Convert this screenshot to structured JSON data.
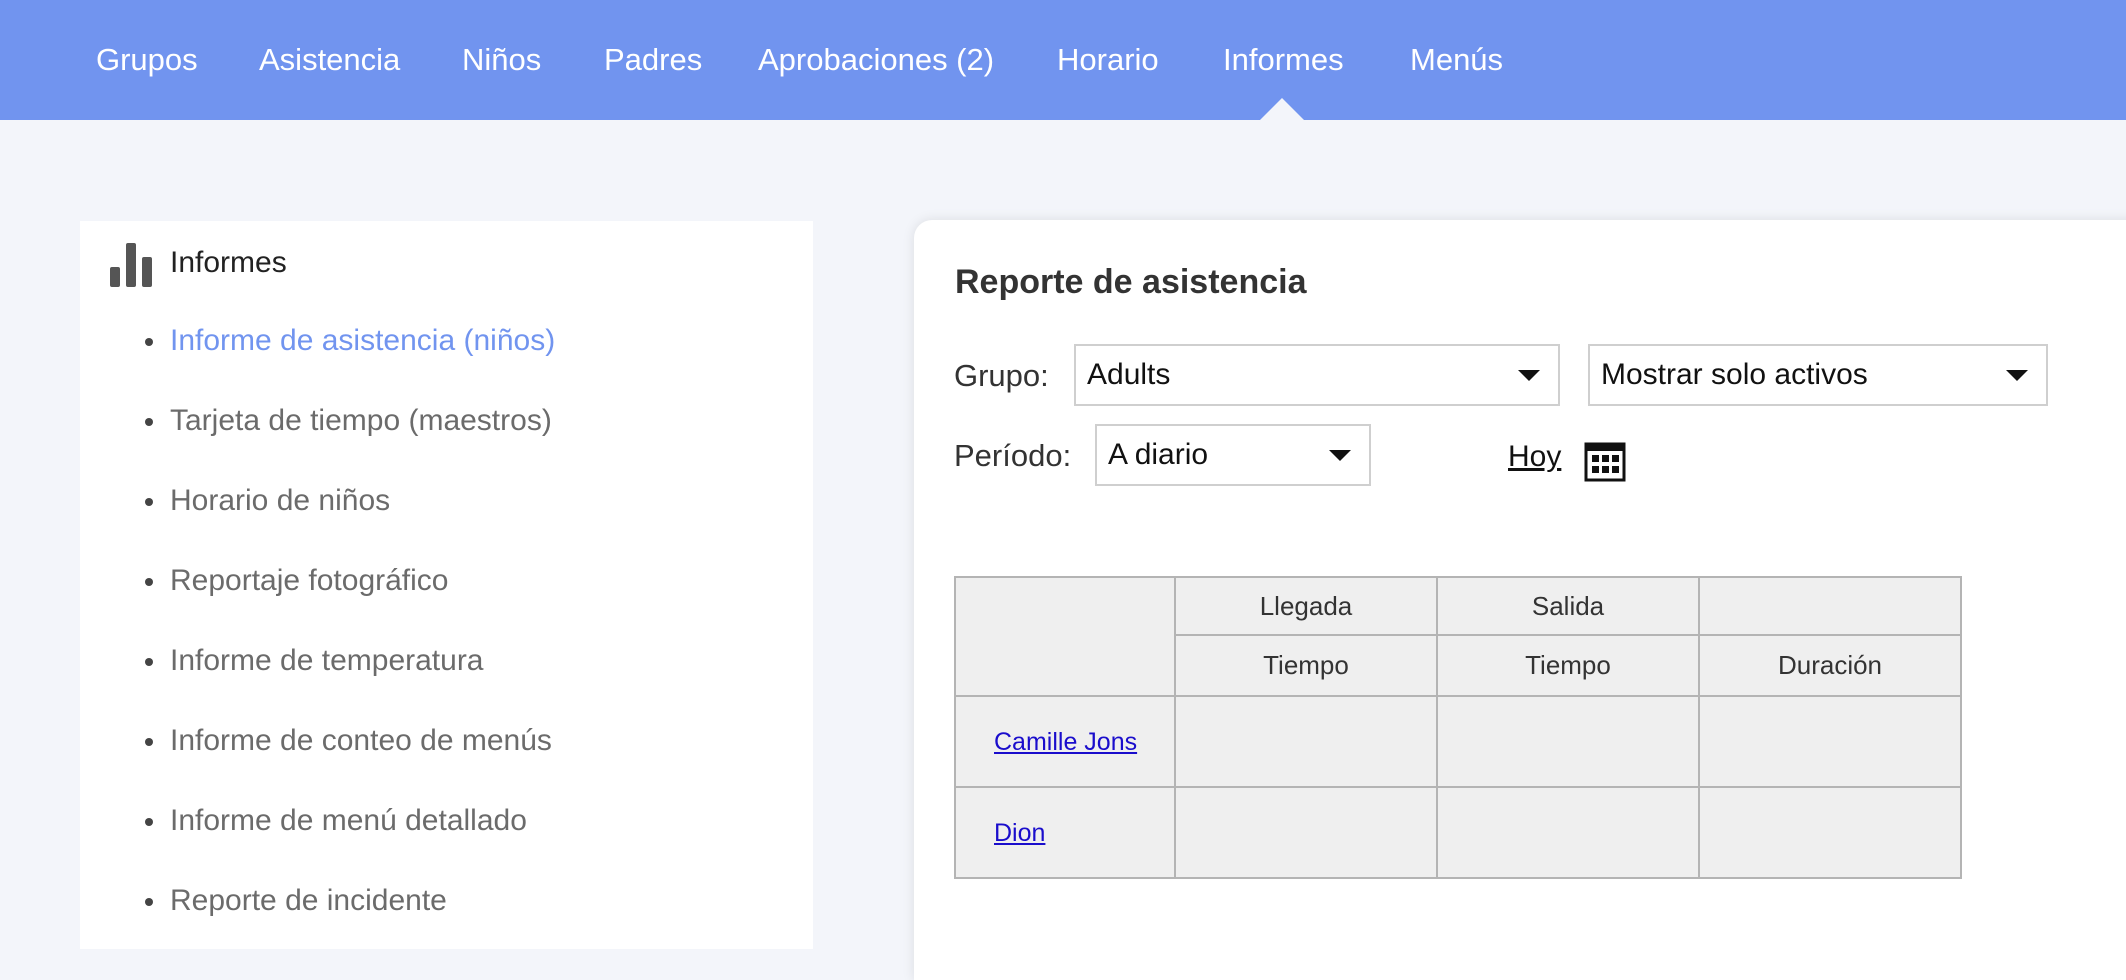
{
  "nav": {
    "items": [
      {
        "label": "Grupos"
      },
      {
        "label": "Asistencia"
      },
      {
        "label": "Niños"
      },
      {
        "label": "Padres"
      },
      {
        "label": "Aprobaciones (2)"
      },
      {
        "label": "Horario"
      },
      {
        "label": "Informes",
        "active": true
      },
      {
        "label": "Menús"
      }
    ]
  },
  "sidebar": {
    "title": "Informes",
    "title_icon": "bar-chart-icon",
    "items": [
      {
        "label": "Informe de asistencia (niños)",
        "active": true
      },
      {
        "label": "Tarjeta de tiempo (maestros)"
      },
      {
        "label": "Horario de niños"
      },
      {
        "label": "Reportaje fotográfico"
      },
      {
        "label": "Informe de temperatura"
      },
      {
        "label": "Informe de conteo de menús"
      },
      {
        "label": "Informe de menú detallado"
      },
      {
        "label": "Reporte de incidente"
      }
    ]
  },
  "report": {
    "title": "Reporte de asistencia",
    "group_label": "Grupo:",
    "group_value": "Adults",
    "filter_value": "Mostrar solo activos",
    "period_label": "Período:",
    "period_value": "A diario",
    "today_link": "Hoy",
    "calendar_icon": "calendar-icon",
    "table": {
      "arrival_header": "Llegada",
      "departure_header": "Salida",
      "arrival_sub": "Tiempo",
      "departure_sub": "Tiempo",
      "duration_header": "Duración",
      "rows": [
        {
          "name": "Camille Jons",
          "arrival": "",
          "departure": "",
          "duration": ""
        },
        {
          "name": "Dion",
          "arrival": "",
          "departure": "",
          "duration": ""
        }
      ]
    }
  },
  "colors": {
    "nav_bg": "#7194ef",
    "accent": "#7194ef",
    "page_bg": "#f3f5fa",
    "link": "#1a0dcc"
  }
}
